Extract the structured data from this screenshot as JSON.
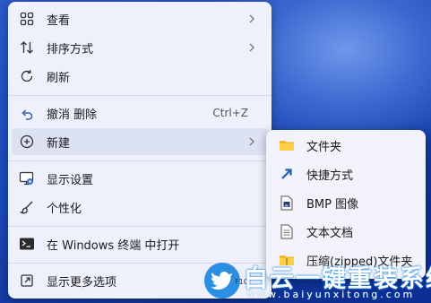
{
  "context_menu": {
    "items": [
      {
        "label": "查看",
        "icon": "grid-icon",
        "has_submenu": true
      },
      {
        "label": "排序方式",
        "icon": "sort-icon",
        "has_submenu": true
      },
      {
        "label": "刷新",
        "icon": "refresh-icon"
      },
      {
        "label": "撤消 删除",
        "icon": "undo-icon",
        "shortcut": "Ctrl+Z"
      },
      {
        "label": "新建",
        "icon": "new-icon",
        "has_submenu": true,
        "highlighted": true
      },
      {
        "label": "显示设置",
        "icon": "display-settings-icon"
      },
      {
        "label": "个性化",
        "icon": "brush-icon"
      },
      {
        "label": "在 Windows 终端 中打开",
        "icon": "terminal-icon"
      },
      {
        "label": "显示更多选项",
        "icon": "more-options-icon",
        "shortcut": "F10"
      }
    ]
  },
  "new_submenu": {
    "items": [
      {
        "label": "文件夹",
        "icon": "folder-icon"
      },
      {
        "label": "快捷方式",
        "icon": "shortcut-icon"
      },
      {
        "label": "BMP 图像",
        "icon": "bmp-image-icon"
      },
      {
        "label": "文本文档",
        "icon": "text-document-icon"
      },
      {
        "label": "压缩(zipped)文件夹",
        "icon": "zip-folder-icon"
      }
    ]
  },
  "watermark": {
    "brand": "白云一键重装系统",
    "url": "www.baiyunxitong.com",
    "brand_color": "#2d8fe3"
  }
}
